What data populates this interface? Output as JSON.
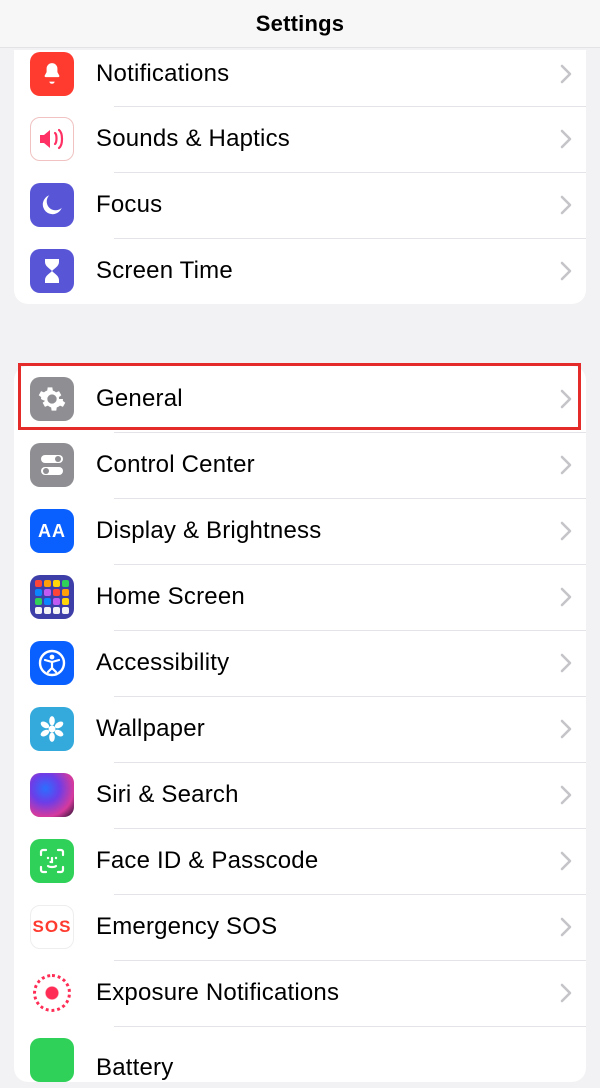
{
  "header": {
    "title": "Settings"
  },
  "group1": {
    "notifications": {
      "label": "Notifications"
    },
    "sounds": {
      "label": "Sounds & Haptics"
    },
    "focus": {
      "label": "Focus"
    },
    "screentime": {
      "label": "Screen Time"
    }
  },
  "group2": {
    "general": {
      "label": "General"
    },
    "controlcenter": {
      "label": "Control Center"
    },
    "display": {
      "label": "Display & Brightness"
    },
    "homescreen": {
      "label": "Home Screen"
    },
    "accessibility": {
      "label": "Accessibility"
    },
    "wallpaper": {
      "label": "Wallpaper"
    },
    "siri": {
      "label": "Siri & Search"
    },
    "faceid": {
      "label": "Face ID & Passcode"
    },
    "sos": {
      "label": "Emergency SOS",
      "icon_text": "SOS"
    },
    "exposure": {
      "label": "Exposure Notifications"
    },
    "battery": {
      "label": "Battery"
    }
  },
  "highlight": {
    "target": "general"
  }
}
